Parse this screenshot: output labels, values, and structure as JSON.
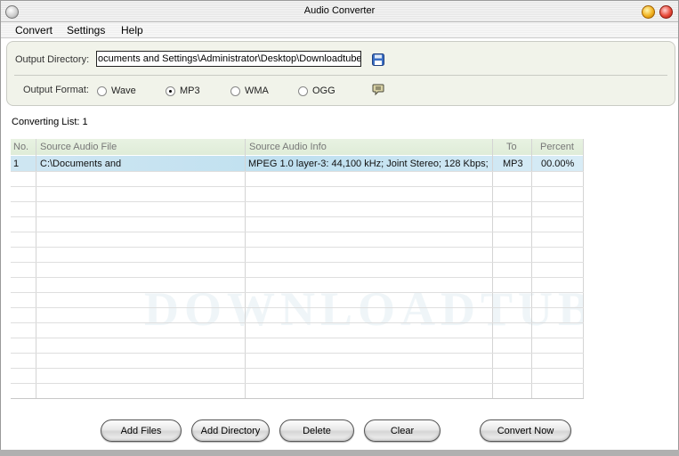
{
  "window": {
    "title": "Audio Converter"
  },
  "menu": [
    {
      "label": "Convert"
    },
    {
      "label": "Settings"
    },
    {
      "label": "Help"
    }
  ],
  "output": {
    "directory_label": "Output Directory:",
    "directory_value": "ocuments and Settings\\Administrator\\Desktop\\Downloadtube",
    "save_icon": "floppy-disk-icon",
    "format_label": "Output Format:",
    "formats": [
      {
        "label": "Wave",
        "checked": false
      },
      {
        "label": "MP3",
        "checked": true
      },
      {
        "label": "WMA",
        "checked": false
      },
      {
        "label": "OGG",
        "checked": false
      }
    ],
    "settings_icon": "speech-bubble-icon"
  },
  "list": {
    "label": "Converting List: 1",
    "columns": [
      "No.",
      "Source Audio File",
      "Source Audio Info",
      "To",
      "Percent"
    ],
    "rows": [
      {
        "no": "1",
        "file": "C:\\Documents and",
        "info": "MPEG 1.0 layer-3: 44,100 kHz; Joint Stereo; 128 Kbps;",
        "to": "MP3",
        "percent": "00.00%"
      }
    ],
    "watermark": "DOWNLOADTUBE"
  },
  "buttons": {
    "add_files": "Add Files",
    "add_directory": "Add Directory",
    "delete": "Delete",
    "clear": "Clear",
    "convert_now": "Convert Now"
  },
  "colors": {
    "panel_bg": "#f1f3ea",
    "header_bg": "#e4efdd",
    "selected_row": "#c6e3f1",
    "save_icon": "#2f5fb0"
  }
}
